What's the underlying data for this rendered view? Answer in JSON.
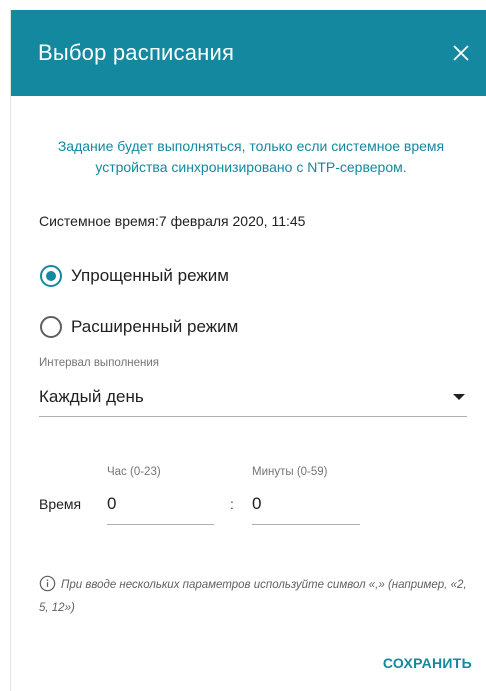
{
  "dialog": {
    "title": "Выбор расписания",
    "notice": "Задание будет выполняться, только если системное время устройства синхронизировано с NTP-сервером.",
    "system_time": "Системное время:7 февраля 2020, 11:45"
  },
  "mode": {
    "options": [
      {
        "label": "Упрощенный режим",
        "checked": true
      },
      {
        "label": "Расширенный режим",
        "checked": false
      }
    ]
  },
  "interval": {
    "label": "Интервал выполнения",
    "value": "Каждый день"
  },
  "time": {
    "label": "Время",
    "hour_label": "Час (0-23)",
    "hour_value": "0",
    "separator": ":",
    "minute_label": "Минуты (0-59)",
    "minute_value": "0"
  },
  "hint": "При вводе нескольких параметров используйте символ «,» (например, «2, 5, 12»)",
  "actions": {
    "save_label": "СОХРАНИТЬ"
  },
  "colors": {
    "accent": "#14889f",
    "header_text": "#ffffff"
  },
  "icons": {
    "close": "close-icon",
    "info": "info-icon",
    "dropdown": "chevron-down-icon"
  }
}
